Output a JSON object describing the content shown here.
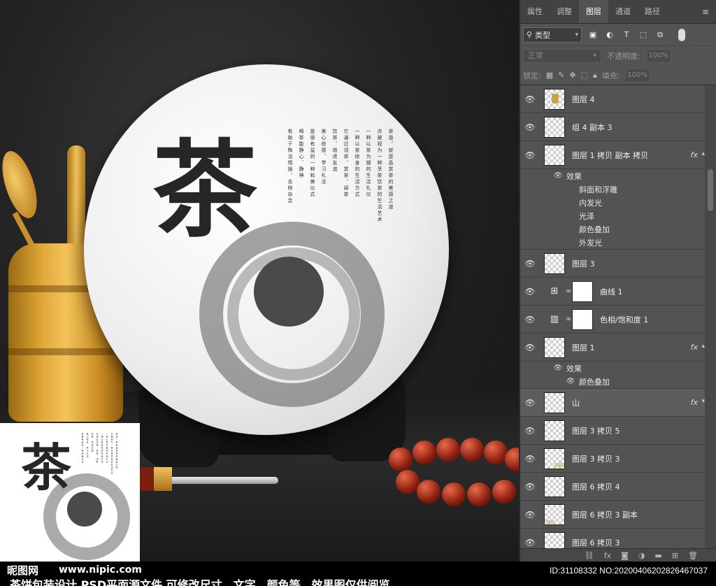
{
  "panel": {
    "tabs": [
      "属性",
      "调整",
      "图层",
      "通道",
      "路径"
    ],
    "active_tab": "图层",
    "filter_label": "类型",
    "blend_mode": "正常",
    "opacity_label": "不透明度:",
    "opacity_value": "100%",
    "lock_label": "锁定:",
    "fill_label": "填充:",
    "fill_value": "100%",
    "layers": [
      {
        "name": "图层 4",
        "kind": "pixel"
      },
      {
        "name": "组 4 副本 3",
        "kind": "pixel"
      },
      {
        "name": "图层 1 拷贝 副本 拷贝",
        "kind": "pixel",
        "fx": "fx",
        "effects_title": "效果",
        "effects": [
          "斜面和浮雕",
          "内发光",
          "光泽",
          "颜色叠加",
          "外发光"
        ]
      },
      {
        "name": "图层 3",
        "kind": "pixel"
      },
      {
        "name": "曲线 1",
        "kind": "curves"
      },
      {
        "name": "色相/饱和度 1",
        "kind": "huesat"
      },
      {
        "name": "图层 1",
        "kind": "pixel",
        "fx": "fx",
        "effects_title": "效果",
        "effects": [
          "颜色叠加"
        ]
      },
      {
        "name": "山",
        "kind": "pixel",
        "fx": "fx"
      },
      {
        "name": "图层 3 拷贝 5",
        "kind": "pixel"
      },
      {
        "name": "图层 3 拷贝 3",
        "kind": "pixel"
      },
      {
        "name": "图层 6 拷贝 4",
        "kind": "pixel"
      },
      {
        "name": "图层 6 拷贝 3 副本",
        "kind": "pixel"
      },
      {
        "name": "图层 6 拷贝 3",
        "kind": "pixel"
      }
    ],
    "footer_icons": [
      "link-icon",
      "fx-icon",
      "mask-icon",
      "adjustment-icon",
      "folder-icon",
      "new-layer-icon",
      "trash-icon"
    ]
  },
  "artwork": {
    "tea_char": "茶",
    "poem_columns": [
      "茶道，就是品赏茶的美感之道",
      "亦被视为一种烹茶饮茶的生活艺术",
      "一种以茶为媒的生活礼仪",
      "一种以茶修身的生活方式",
      "它通过沏茶、赏茶、闻茶",
      "饮茶、增进友谊",
      "美心修德、学习礼法",
      "是很有益的一种和美仪式",
      "喝茶能静心、静神",
      "有助于陶冶情操、去除杂念"
    ]
  },
  "watermark": {
    "logo": "昵图网",
    "site": "www.nipic.com",
    "id_text": "ID:31108332 NO:20200406202826467037",
    "caption": "茶饼包装设计  PSD平面源文件 可修改尺寸，文字，颜色等，效果图仅供阅览"
  }
}
